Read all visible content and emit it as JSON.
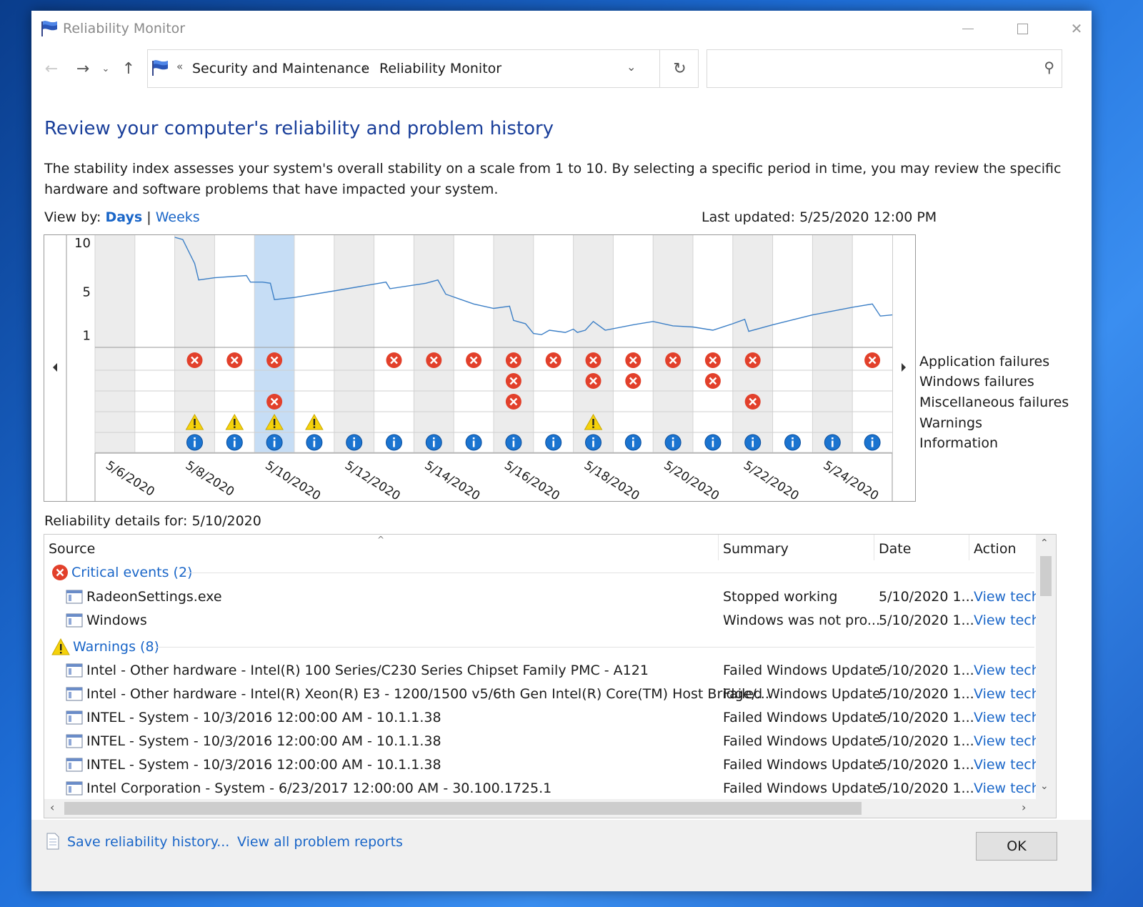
{
  "window": {
    "title": "Reliability Monitor"
  },
  "address": {
    "prefix": "«",
    "crumbs": [
      "Security and Maintenance",
      "Reliability Monitor"
    ],
    "separator": "›",
    "search_placeholder": ""
  },
  "page": {
    "title": "Review your computer's reliability and problem history",
    "description": "The stability index assesses your system's overall stability on a scale from 1 to 10. By selecting a specific period in time, you may review the specific hardware and software problems that have impacted your system.",
    "view_by_label": "View by:",
    "view_days": "Days",
    "view_weeks": "Weeks",
    "view_sep": "|",
    "last_updated": "Last updated: 5/25/2020 12:00 PM"
  },
  "chart_data": {
    "type": "line",
    "y_ticks": [
      10,
      5,
      1
    ],
    "ylim": [
      0,
      10
    ],
    "days": [
      "5/6/2020",
      "5/7/2020",
      "5/8/2020",
      "5/9/2020",
      "5/10/2020",
      "5/11/2020",
      "5/12/2020",
      "5/13/2020",
      "5/14/2020",
      "5/15/2020",
      "5/16/2020",
      "5/17/2020",
      "5/18/2020",
      "5/19/2020",
      "5/20/2020",
      "5/21/2020",
      "5/22/2020",
      "5/23/2020",
      "5/24/2020",
      "5/25/2020"
    ],
    "x_tick_labels": [
      "5/6/2020",
      "5/8/2020",
      "5/10/2020",
      "5/12/2020",
      "5/14/2020",
      "5/16/2020",
      "5/18/2020",
      "5/20/2020",
      "5/22/2020",
      "5/24/2020"
    ],
    "selected_day": "5/10/2020",
    "stability_index": [
      [
        2.0,
        10.0
      ],
      [
        2.2,
        9.8
      ],
      [
        2.5,
        7.6
      ],
      [
        2.6,
        6.1
      ],
      [
        3.0,
        6.3
      ],
      [
        3.8,
        6.5
      ],
      [
        3.9,
        5.9
      ],
      [
        4.2,
        5.9
      ],
      [
        4.4,
        5.8
      ],
      [
        4.5,
        4.3
      ],
      [
        5.0,
        4.5
      ],
      [
        6.0,
        5.1
      ],
      [
        7.3,
        5.9
      ],
      [
        7.4,
        5.3
      ],
      [
        8.3,
        5.8
      ],
      [
        8.6,
        6.1
      ],
      [
        8.8,
        4.8
      ],
      [
        9.5,
        3.9
      ],
      [
        10.0,
        3.5
      ],
      [
        10.4,
        3.7
      ],
      [
        10.5,
        2.4
      ],
      [
        10.8,
        2.1
      ],
      [
        11.0,
        1.2
      ],
      [
        11.2,
        1.1
      ],
      [
        11.4,
        1.5
      ],
      [
        11.8,
        1.3
      ],
      [
        12.0,
        1.6
      ],
      [
        12.1,
        1.3
      ],
      [
        12.3,
        1.5
      ],
      [
        12.5,
        2.3
      ],
      [
        12.8,
        1.5
      ],
      [
        13.5,
        2.0
      ],
      [
        14.0,
        2.3
      ],
      [
        14.5,
        1.9
      ],
      [
        15.0,
        1.8
      ],
      [
        15.5,
        1.5
      ],
      [
        16.0,
        2.1
      ],
      [
        16.3,
        2.5
      ],
      [
        16.4,
        1.4
      ],
      [
        17.0,
        2.0
      ],
      [
        18.0,
        2.9
      ],
      [
        19.0,
        3.6
      ],
      [
        19.5,
        3.9
      ],
      [
        19.7,
        2.8
      ],
      [
        20.0,
        2.9
      ]
    ],
    "event_rows": [
      "Application failures",
      "Windows failures",
      "Miscellaneous failures",
      "Warnings",
      "Information"
    ],
    "events": {
      "Application failures": [
        2,
        3,
        4,
        7,
        8,
        9,
        10,
        11,
        12,
        13,
        14,
        15,
        16,
        19
      ],
      "Windows failures": [
        10,
        12,
        13,
        15
      ],
      "Miscellaneous failures": [
        4,
        10,
        16
      ],
      "Warnings": [
        2,
        3,
        4,
        5,
        12
      ],
      "Information": [
        2,
        3,
        4,
        5,
        6,
        7,
        8,
        9,
        10,
        11,
        12,
        13,
        14,
        15,
        16,
        17,
        18,
        19
      ]
    },
    "colors": {
      "line": "#3c7fc6",
      "error": "#e2402b",
      "warning": "#f5d20b",
      "info": "#1b74d0",
      "selected": "#c6ddf5",
      "shaded": "#ececec"
    }
  },
  "details": {
    "label": "Reliability details for: 5/10/2020",
    "columns": {
      "source": "Source",
      "summary": "Summary",
      "date": "Date",
      "action": "Action"
    },
    "groups": [
      {
        "type": "error",
        "label": "Critical events (2)"
      },
      {
        "type": "warning",
        "label": "Warnings (8)"
      }
    ],
    "rows": [
      {
        "group": 0,
        "source": "RadeonSettings.exe",
        "summary": "Stopped working",
        "date": "5/10/2020 1...",
        "action": "View tech"
      },
      {
        "group": 0,
        "source": "Windows",
        "summary": "Windows was not pro...",
        "date": "5/10/2020 1...",
        "action": "View tech"
      },
      {
        "group": 1,
        "source": "Intel - Other hardware - Intel(R) 100 Series/C230 Series Chipset Family PMC - A121",
        "summary": "Failed Windows Update",
        "date": "5/10/2020 1...",
        "action": "View tech"
      },
      {
        "group": 1,
        "source": "Intel - Other hardware - Intel(R) Xeon(R) E3 - 1200/1500 v5/6th Gen Intel(R) Core(TM) Host Bridge/...",
        "summary": "Failed Windows Update",
        "date": "5/10/2020 1...",
        "action": "View tech"
      },
      {
        "group": 1,
        "source": "INTEL - System - 10/3/2016 12:00:00 AM - 10.1.1.38",
        "summary": "Failed Windows Update",
        "date": "5/10/2020 1...",
        "action": "View tech"
      },
      {
        "group": 1,
        "source": "INTEL - System - 10/3/2016 12:00:00 AM - 10.1.1.38",
        "summary": "Failed Windows Update",
        "date": "5/10/2020 1...",
        "action": "View tech"
      },
      {
        "group": 1,
        "source": "INTEL - System - 10/3/2016 12:00:00 AM - 10.1.1.38",
        "summary": "Failed Windows Update",
        "date": "5/10/2020 1...",
        "action": "View tech"
      },
      {
        "group": 1,
        "source": "Intel Corporation - System - 6/23/2017 12:00:00 AM - 30.100.1725.1",
        "summary": "Failed Windows Update",
        "date": "5/10/2020 1...",
        "action": "View tech"
      }
    ]
  },
  "footer": {
    "save_link": "Save reliability history...",
    "problems_link": "View all problem reports",
    "ok": "OK"
  }
}
